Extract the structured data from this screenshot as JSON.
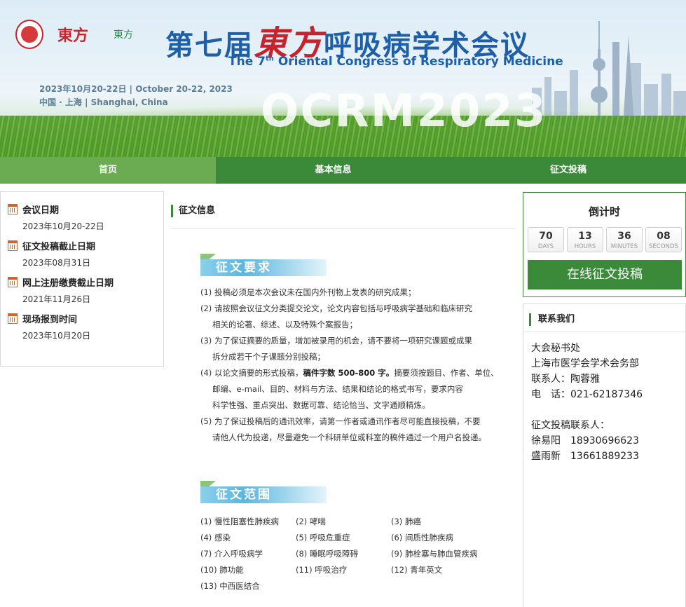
{
  "banner": {
    "title_prefix": "第七届",
    "title_red": "東方",
    "title_suffix": "呼吸病学术会议",
    "title_en_pre": "The 7",
    "title_en_sup": "th",
    "title_en_post": "Oriental Congress of Respiratory Medicine",
    "date_line1": "2023年10月20-22日 | October 20-22, 2023",
    "date_line2": "中国 · 上海 | Shanghai, China",
    "big_text": "OCRM2023",
    "logo2_text": "東方",
    "logo3_text": "東方"
  },
  "nav": {
    "home": "首页",
    "info": "基本信息",
    "submit": "征文投稿"
  },
  "sidebar": {
    "items": [
      {
        "label": "会议日期",
        "value": "2023年10月20-22日"
      },
      {
        "label": "征文投稿截止日期",
        "value": "2023年08月31日"
      },
      {
        "label": "网上注册缴费截止日期",
        "value": "2021年11月26日"
      },
      {
        "label": "现场报到时间",
        "value": "2023年10月20日"
      }
    ]
  },
  "main": {
    "section_title": "征文信息",
    "req_title": "征文要求",
    "req_lines": [
      "(1) 投稿必须是本次会议未在国内外刊物上发表的研究成果；",
      "(2) 请按照会议征文分类提交论文，论文内容包括与呼吸病学基础和临床研究",
      "相关的论著、综述、以及特殊个案报告；",
      "(3) 为了保证摘要的质量，增加被录用的机会，请不要将一项研究课题或成果",
      "拆分成若干个子课题分别投稿；",
      "(4) 以论文摘要的形式投稿，",
      "稿件字数 500-800 字。",
      "摘要须按题目、作者、单位、",
      "邮编、e-mail、目的、材料与方法、结果和结论的格式书写，要求内容",
      "科学性强、重点突出、数据可靠、结论恰当、文字通顺精炼。",
      "(5) 为了保证投稿后的通讯效率，请第一作者或通讯作者尽可能直接投稿，不要",
      "请他人代为投递，尽量避免一个科研单位或科室的稿件通过一个用户名投递。"
    ],
    "scope_title": "征文范围",
    "scope": [
      "(1) 慢性阻塞性肺疾病",
      "(2) 哮喘",
      "(3) 肺癌",
      "(4) 感染",
      "(5) 呼吸危重症",
      "(6) 间质性肺疾病",
      "(7) 介入呼吸病学",
      "(8) 睡眠呼吸障碍",
      "(9) 肺栓塞与肺血管疾病",
      "(10) 肺功能",
      "(11) 呼吸治疗",
      "(12) 青年英文",
      "(13) 中西医结合"
    ]
  },
  "countdown": {
    "title": "倒计时",
    "units": [
      {
        "num": "70",
        "label": "DAYS"
      },
      {
        "num": "13",
        "label": "HOURS"
      },
      {
        "num": "36",
        "label": "MINUTES"
      },
      {
        "num": "08",
        "label": "SECONDS"
      }
    ],
    "button": "在线征文投稿"
  },
  "contact": {
    "title": "联系我们",
    "lines1": [
      "大会秘书处",
      "上海市医学会学术会务部",
      "联系人：陶蓉雅",
      "电　话：021-62187346"
    ],
    "lines2": [
      "征文投稿联系人：",
      "徐易阳　18930696623",
      "盛雨新　13661889233"
    ]
  },
  "colors": {
    "nav_green": "#3a8a3a",
    "nav_home": "#6bab52",
    "title_blue": "#1f5fa8",
    "accent_red": "#c8232c"
  }
}
